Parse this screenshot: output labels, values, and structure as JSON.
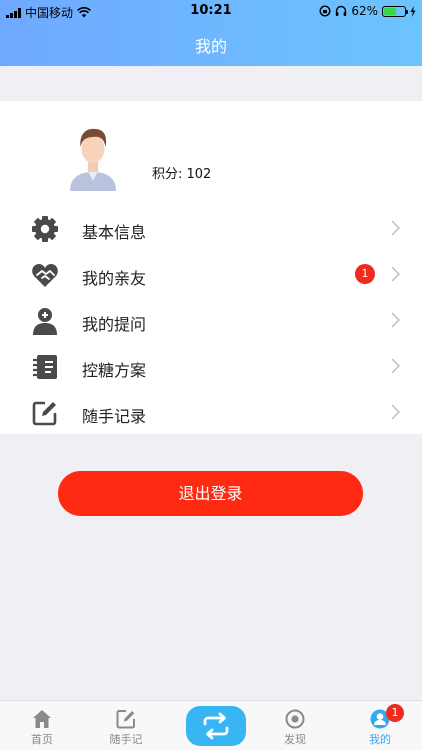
{
  "status_bar": {
    "carrier": "中国移动",
    "time": "10:21",
    "battery": "62%",
    "battery_level": 0.62
  },
  "header": {
    "title": "我的"
  },
  "profile": {
    "points_label": "积分: 102"
  },
  "menu": [
    {
      "label": "基本信息",
      "icon": "gear-icon"
    },
    {
      "label": "我的亲友",
      "icon": "heart-handshake-icon",
      "badge": "1"
    },
    {
      "label": "我的提问",
      "icon": "doctor-icon"
    },
    {
      "label": "控糖方案",
      "icon": "notebook-icon"
    },
    {
      "label": "随手记录",
      "icon": "edit-icon"
    }
  ],
  "logout_label": "退出登录",
  "tabbar": {
    "items": [
      {
        "label": "首页",
        "icon": "home-icon"
      },
      {
        "label": "随手记",
        "icon": "edit-icon"
      },
      {
        "label": "",
        "icon": "swap-arrows-icon"
      },
      {
        "label": "发现",
        "icon": "target-icon"
      },
      {
        "label": "我的",
        "icon": "user-icon",
        "active": true,
        "badge": "1"
      }
    ]
  },
  "colors": {
    "header_start": "#6fa9ff",
    "header_end": "#6cc4ff",
    "logout": "#ff2a12",
    "badge": "#f02a1e",
    "tab_active": "#31a9f3",
    "icon": "#4a4a4a"
  }
}
